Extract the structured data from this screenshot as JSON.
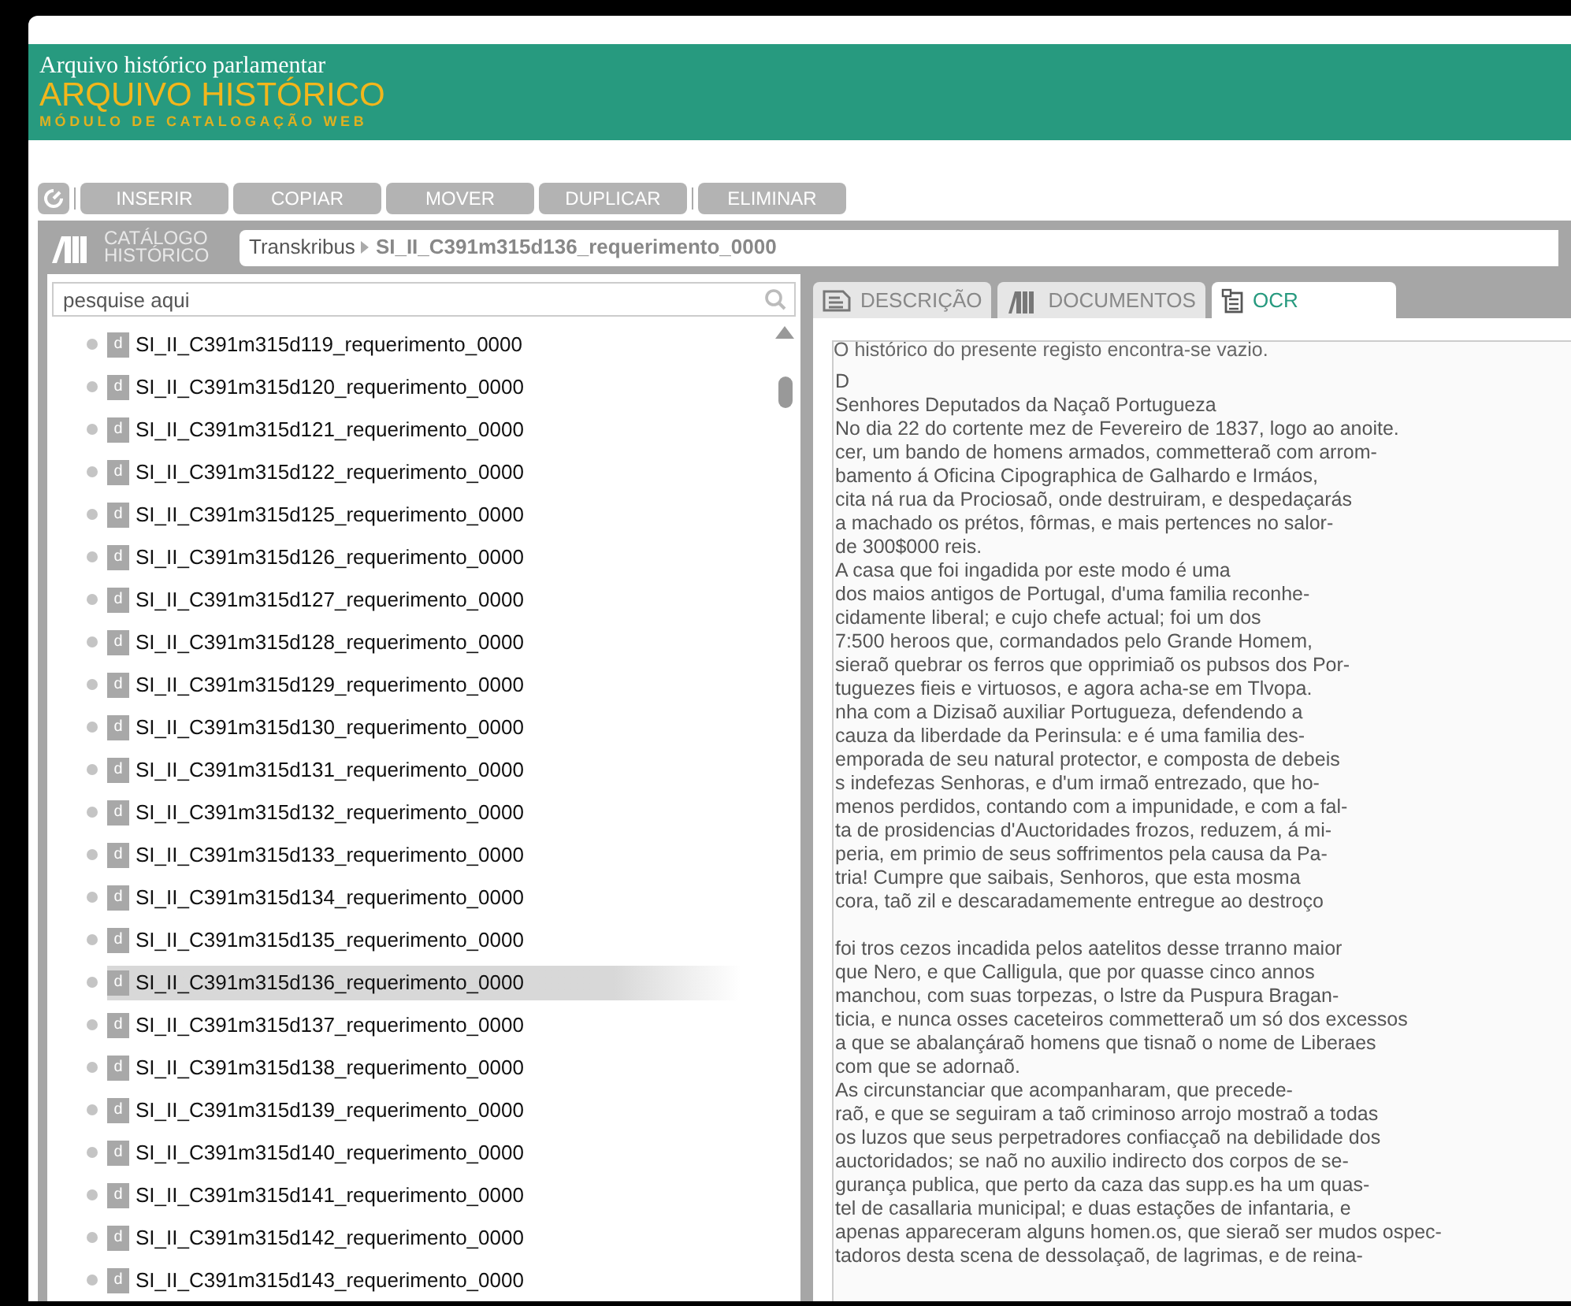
{
  "header": {
    "subtitle": "Arquivo histórico parlamentar",
    "title": "ARQUIVO HISTÓRICO",
    "tagline": "MÓDULO DE CATALOGAÇÃO WEB"
  },
  "toolbar": {
    "buttons": [
      "INSERIR",
      "COPIAR",
      "MOVER",
      "DUPLICAR",
      "ELIMINAR"
    ]
  },
  "catalog": {
    "label_line1": "CATÁLOGO",
    "label_line2": "HISTÓRICO"
  },
  "breadcrumb": {
    "root": "Transkribus",
    "current": "SI_II_C391m315d136_requerimento_0000"
  },
  "search": {
    "placeholder": "pesquise aqui"
  },
  "tree": {
    "items": [
      {
        "badge": "d",
        "label": "SI_II_C391m315d119_requerimento_0000",
        "selected": false
      },
      {
        "badge": "d",
        "label": "SI_II_C391m315d120_requerimento_0000",
        "selected": false
      },
      {
        "badge": "d",
        "label": "SI_II_C391m315d121_requerimento_0000",
        "selected": false
      },
      {
        "badge": "d",
        "label": "SI_II_C391m315d122_requerimento_0000",
        "selected": false
      },
      {
        "badge": "d",
        "label": "SI_II_C391m315d125_requerimento_0000",
        "selected": false
      },
      {
        "badge": "d",
        "label": "SI_II_C391m315d126_requerimento_0000",
        "selected": false
      },
      {
        "badge": "d",
        "label": "SI_II_C391m315d127_requerimento_0000",
        "selected": false
      },
      {
        "badge": "d",
        "label": "SI_II_C391m315d128_requerimento_0000",
        "selected": false
      },
      {
        "badge": "d",
        "label": "SI_II_C391m315d129_requerimento_0000",
        "selected": false
      },
      {
        "badge": "d",
        "label": "SI_II_C391m315d130_requerimento_0000",
        "selected": false
      },
      {
        "badge": "d",
        "label": "SI_II_C391m315d131_requerimento_0000",
        "selected": false
      },
      {
        "badge": "d",
        "label": "SI_II_C391m315d132_requerimento_0000",
        "selected": false
      },
      {
        "badge": "d",
        "label": "SI_II_C391m315d133_requerimento_0000",
        "selected": false
      },
      {
        "badge": "d",
        "label": "SI_II_C391m315d134_requerimento_0000",
        "selected": false
      },
      {
        "badge": "d",
        "label": "SI_II_C391m315d135_requerimento_0000",
        "selected": false
      },
      {
        "badge": "d",
        "label": "SI_II_C391m315d136_requerimento_0000",
        "selected": true
      },
      {
        "badge": "d",
        "label": "SI_II_C391m315d137_requerimento_0000",
        "selected": false
      },
      {
        "badge": "d",
        "label": "SI_II_C391m315d138_requerimento_0000",
        "selected": false
      },
      {
        "badge": "d",
        "label": "SI_II_C391m315d139_requerimento_0000",
        "selected": false
      },
      {
        "badge": "d",
        "label": "SI_II_C391m315d140_requerimento_0000",
        "selected": false
      },
      {
        "badge": "d",
        "label": "SI_II_C391m315d141_requerimento_0000",
        "selected": false
      },
      {
        "badge": "d",
        "label": "SI_II_C391m315d142_requerimento_0000",
        "selected": false
      },
      {
        "badge": "d",
        "label": "SI_II_C391m315d143_requerimento_0000",
        "selected": false
      }
    ]
  },
  "tabs": [
    {
      "label": "DESCRIÇÃO",
      "kind": "description",
      "selected": false
    },
    {
      "label": "DOCUMENTOS",
      "kind": "documents",
      "selected": false
    },
    {
      "label": "OCR",
      "kind": "ocr",
      "selected": true
    }
  ],
  "ocr": {
    "notice": "O histórico do presente registo encontra-se vazio.",
    "blocks": [
      [
        "D",
        "Senhores Deputados da Naçaõ Portugueza",
        "No dia 22 do cortente mez de Fevereiro de 1837, logo ao anoite.",
        "cer, um bando de homens armados, commetteraõ com arrom-",
        "bamento á Oficina Cipographica de Galhardo e Irmáos,",
        "cita ná rua da Prociosaõ, onde destruiram, e despedaçarás",
        "a machado os prétos, fôrmas, e mais pertences no salor-",
        "de 300$000 reis.",
        "A casa que foi ingadida por este modo é uma",
        "dos maios antigos de Portugal, d'uma familia reconhe-",
        "cidamente liberal; e cujo chefe actual; foi um dos",
        "7:500 heroos que, cormandados pelo Grande Homem,",
        "sieraõ quebrar os ferros que opprimiaõ os pubsos dos Por-",
        "tuguezes fieis e virtuosos, e agora acha-se em Tlvopa.",
        "nha com a Dizisaõ auxiliar Portugueza, defendendo a",
        "cauza da liberdade da Perinsula: e é uma familia des-",
        "emporada de seu natural protector, e composta de debeis",
        "s indefezas Senhoras, e d'um irmaõ entrezado, que ho-",
        "menos perdidos, contando com a impunidade, e com a fal-",
        "ta de prosidencias d'Auctoridades frozos, reduzem, á mi-",
        "peria, em primio de seus soffrimentos pela causa da Pa-",
        "tria! Cumpre que saibais, Senhoros, que esta mosma",
        "cora, taõ zil e descaradamemente entregue ao destroço"
      ],
      [
        "foi tros cezos incadida pelos aatelitos desse trranno maior",
        "que Nero, e que Calligula, que por quasse cinco annos",
        "manchou, com suas torpezas, o lstre da Puspura Bragan-",
        "ticia, e nunca osses caceteiros commetteraõ um só dos excessos",
        "a que se abalançáraõ homens que tisnaõ o nome de Liberaes",
        "com que se adornaõ.",
        "As circunstanciar que acompanharam, que precede-",
        "raõ, e que se seguiram a taõ criminoso arrojo mostraõ a todas",
        "os luzos que seus perpetradores confiacçaõ na debilidade dos",
        "auctoridados; se naõ no auxilio indirecto dos corpos de se-",
        "gurança publica, que perto da caza das supp.es ha um quas-",
        "tel de casallaria municipal; e duas estações de infantaria, e",
        "apenas appareceram alguns homen.os, que sieraõ ser mudos ospec-",
        "tadoros desta scena de dessolaçaõ, de lagrimas, e de reina-"
      ]
    ]
  }
}
